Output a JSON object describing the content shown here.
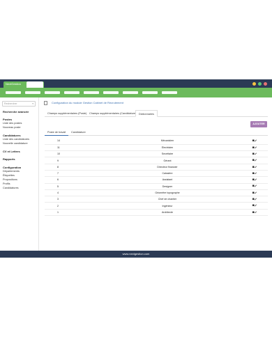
{
  "window": {
    "tab_label": "NextGestion"
  },
  "colors": {
    "header": "#2b3a55",
    "nav": "#6cba5c",
    "accent": "#a67bb3",
    "link": "#3a6fb0",
    "dot_yellow": "#f4c542",
    "dot_green": "#5ac87a",
    "dot_red": "#e57373"
  },
  "sidebar": {
    "search_placeholder": "Rechercher",
    "sections": [
      {
        "heading": "Recherche avancée",
        "items": []
      },
      {
        "heading": "Postes",
        "items": [
          "Liste des postes",
          "Nouveau poste"
        ]
      },
      {
        "heading": "Candidatures",
        "items": [
          "Liste des candidatures",
          "Nouvelle candidature"
        ]
      },
      {
        "heading": "CV et Lettres",
        "items": []
      },
      {
        "heading": "Rapports",
        "items": []
      },
      {
        "heading": "Configuration",
        "items": [
          "Départements",
          "Étiquettes",
          "Propositions",
          "Profils",
          "Candidatures"
        ]
      }
    ]
  },
  "breadcrumb": "Configuration du module Gestion Cabinet de Recrutement",
  "tabs": [
    "Champs supplémentaires (Poste)",
    "Champs supplémentaires (Candidatures)",
    "Dictionnaires"
  ],
  "add_button": "AJOUTER",
  "subtabs": [
    "Poste de travail",
    "Candidature"
  ],
  "rows": [
    {
      "num": "14",
      "name": "Mécanicien"
    },
    {
      "num": "11",
      "name": "Electricien"
    },
    {
      "num": "10",
      "name": "Secrétaire"
    },
    {
      "num": "9",
      "name": "Gérant"
    },
    {
      "num": "8",
      "name": "Directeur financier"
    },
    {
      "num": "7",
      "name": "Caissière"
    },
    {
      "num": "6",
      "name": "Assistant"
    },
    {
      "num": "5",
      "name": "Designer"
    },
    {
      "num": "4",
      "name": "Géomètre topographe"
    },
    {
      "num": "3",
      "name": "Chef de chantier"
    },
    {
      "num": "2",
      "name": "Ingénieur"
    },
    {
      "num": "1",
      "name": "Architecte"
    }
  ],
  "footer": "www.nextgestion.com"
}
